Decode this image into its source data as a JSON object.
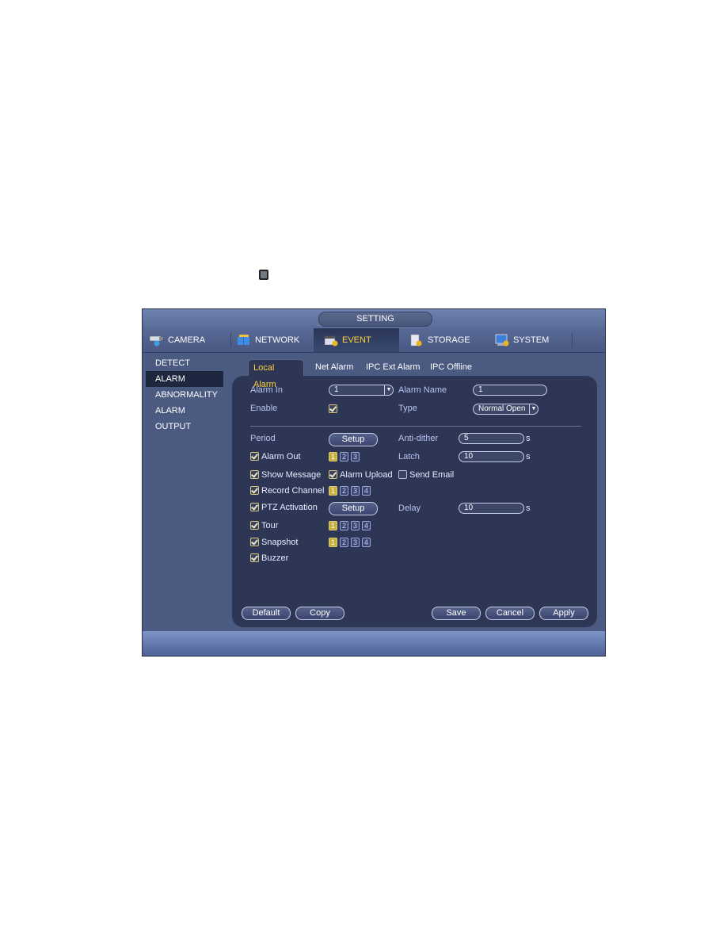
{
  "window": {
    "title": "SETTING"
  },
  "main_tabs": [
    {
      "label": "CAMERA",
      "icon": "camera-icon",
      "active": false
    },
    {
      "label": "NETWORK",
      "icon": "network-icon",
      "active": false
    },
    {
      "label": "EVENT",
      "icon": "event-icon",
      "active": true
    },
    {
      "label": "STORAGE",
      "icon": "storage-icon",
      "active": false
    },
    {
      "label": "SYSTEM",
      "icon": "system-icon",
      "active": false
    }
  ],
  "sidebar": {
    "items": [
      {
        "label": "DETECT",
        "active": false
      },
      {
        "label": "ALARM",
        "active": true
      },
      {
        "label": "ABNORMALITY",
        "active": false
      },
      {
        "label": "ALARM OUTPUT",
        "active": false
      }
    ]
  },
  "sub_tabs": [
    {
      "label": "Local Alarm",
      "active": true
    },
    {
      "label": "Net Alarm",
      "active": false
    },
    {
      "label": "IPC Ext Alarm",
      "active": false
    },
    {
      "label": "IPC Offline",
      "active": false
    }
  ],
  "form": {
    "alarm_in": {
      "label": "Alarm In",
      "value": "1"
    },
    "alarm_name": {
      "label": "Alarm Name",
      "value": "1"
    },
    "enable": {
      "label": "Enable",
      "checked": true
    },
    "type": {
      "label": "Type",
      "value": "Normal Open"
    },
    "period": {
      "label": "Period",
      "button": "Setup"
    },
    "anti_dither": {
      "label": "Anti-dither",
      "value": "5",
      "unit": "s"
    },
    "alarm_out": {
      "label": "Alarm Out",
      "checked": true,
      "channels": [
        "1",
        "2",
        "3"
      ],
      "selected": [
        "1"
      ]
    },
    "latch": {
      "label": "Latch",
      "value": "10",
      "unit": "s"
    },
    "show_message": {
      "label": "Show Message",
      "checked": true
    },
    "alarm_upload": {
      "label": "Alarm Upload",
      "checked": true
    },
    "send_email": {
      "label": "Send Email",
      "checked": false
    },
    "record_channel": {
      "label": "Record Channel",
      "checked": true,
      "channels": [
        "1",
        "2",
        "3",
        "4"
      ],
      "selected": [
        "1"
      ]
    },
    "ptz_activation": {
      "label": "PTZ Activation",
      "checked": true,
      "button": "Setup"
    },
    "delay": {
      "label": "Delay",
      "value": "10",
      "unit": "s"
    },
    "tour": {
      "label": "Tour",
      "checked": true,
      "channels": [
        "1",
        "2",
        "3",
        "4"
      ],
      "selected": [
        "1"
      ]
    },
    "snapshot": {
      "label": "Snapshot",
      "checked": true,
      "channels": [
        "1",
        "2",
        "3",
        "4"
      ],
      "selected": [
        "1"
      ]
    },
    "buzzer": {
      "label": "Buzzer",
      "checked": true
    }
  },
  "buttons": {
    "default": "Default",
    "copy": "Copy",
    "save": "Save",
    "cancel": "Cancel",
    "apply": "Apply"
  }
}
